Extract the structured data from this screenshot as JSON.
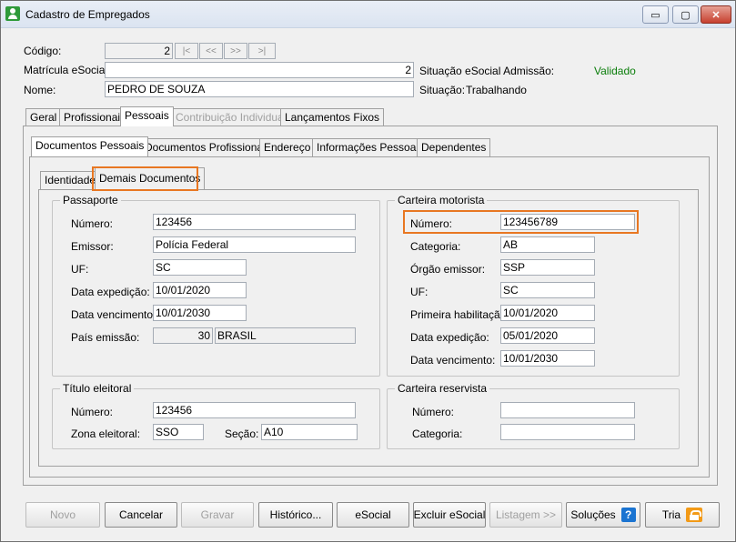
{
  "window": {
    "title": "Cadastro de Empregados",
    "minimize": "▭",
    "maximize": "▢",
    "close": "✕"
  },
  "header": {
    "codigo_label": "Código:",
    "codigo_value": "2",
    "nav": [
      "|<",
      "<<",
      ">>",
      ">|"
    ],
    "matricula_label": "Matrícula eSocial:",
    "matricula_value": "2",
    "nome_label": "Nome:",
    "nome_value": "PEDRO DE SOUZA",
    "situacao_esocial_label": "Situação eSocial Admissão:",
    "situacao_esocial_value": "Validado",
    "situacao_label": "Situação:",
    "situacao_value": "Trabalhando"
  },
  "main_tabs": [
    "Geral",
    "Profissionais",
    "Pessoais",
    "Contribuição Individual",
    "Lançamentos Fixos"
  ],
  "sub_tabs": [
    "Documentos Pessoais",
    "Documentos Profissionais",
    "Endereço",
    "Informações Pessoais",
    "Dependentes"
  ],
  "doc_tabs": [
    "Identidade",
    "Demais Documentos"
  ],
  "passaporte": {
    "title": "Passaporte",
    "numero_label": "Número:",
    "numero": "123456",
    "emissor_label": "Emissor:",
    "emissor": "Polícia Federal",
    "uf_label": "UF:",
    "uf": "SC",
    "data_expedicao_label": "Data expedição:",
    "data_expedicao": "10/01/2020",
    "data_vencimento_label": "Data vencimento:",
    "data_vencimento": "10/01/2030",
    "pais_label": "País emissão:",
    "pais_codigo": "30",
    "pais_nome": "BRASIL"
  },
  "carteira_motorista": {
    "title": "Carteira motorista",
    "numero_label": "Número:",
    "numero": "123456789",
    "categoria_label": "Categoria:",
    "categoria": "AB",
    "orgao_label": "Órgão emissor:",
    "orgao": "SSP",
    "uf_label": "UF:",
    "uf": "SC",
    "primeira_label": "Primeira habilitação:",
    "primeira": "10/01/2020",
    "data_expedicao_label": "Data expedição:",
    "data_expedicao": "05/01/2020",
    "data_vencimento_label": "Data vencimento:",
    "data_vencimento": "10/01/2030"
  },
  "titulo_eleitoral": {
    "title": "Título eleitoral",
    "numero_label": "Número:",
    "numero": "123456",
    "zona_label": "Zona eleitoral:",
    "zona": "SSO",
    "secao_label": "Seção:",
    "secao": "A10"
  },
  "carteira_reservista": {
    "title": "Carteira reservista",
    "numero_label": "Número:",
    "numero": "",
    "categoria_label": "Categoria:",
    "categoria": ""
  },
  "buttons": {
    "novo": "Novo",
    "cancelar": "Cancelar",
    "gravar": "Gravar",
    "historico": "Histórico...",
    "esocial": "eSocial",
    "excluir_esocial": "Excluir eSocial",
    "listagem": "Listagem >>",
    "solucoes": "Soluções",
    "help": "?",
    "tria": "Tria"
  },
  "colors": {
    "highlight": "#e87722",
    "validado": "#0a7d0a",
    "help_icon": "#1b74d1",
    "lock_icon": "#f29a17"
  }
}
